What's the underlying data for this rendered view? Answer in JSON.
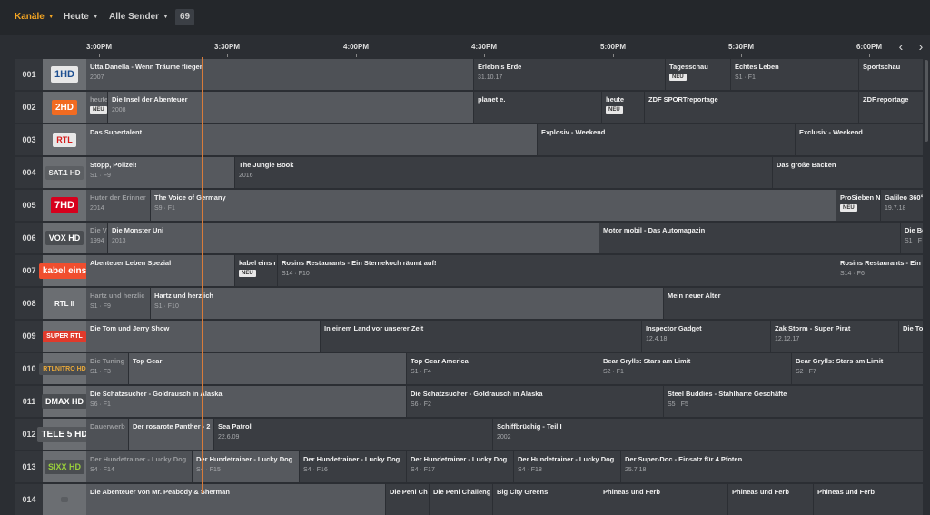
{
  "nav": {
    "items": [
      {
        "label": "Kanäle",
        "active": true
      },
      {
        "label": "Heute",
        "active": false
      },
      {
        "label": "Alle Sender",
        "active": false
      }
    ],
    "count": "69"
  },
  "timeline": {
    "times": [
      "3:00PM",
      "3:30PM",
      "4:00PM",
      "4:30PM",
      "5:00PM",
      "5:30PM",
      "6:00PM"
    ]
  },
  "colors": {
    "accent": "#f5a623",
    "now_line": "#d77b3a"
  },
  "channels": [
    {
      "num": "001",
      "logo": "1HD",
      "programs": [
        {
          "title": "Utta Danella - Wenn Träume fliegen",
          "sub": "2007"
        },
        {
          "title": "Erlebnis Erde",
          "sub": "31.10.17"
        },
        {
          "title": "Tagesschau",
          "badge": "NEU"
        },
        {
          "title": "Echtes Leben",
          "sub": "S1 · F1"
        },
        {
          "title": "Sportschau"
        }
      ]
    },
    {
      "num": "002",
      "logo": "2HD",
      "programs": [
        {
          "title": "heute",
          "badge": "NEU"
        },
        {
          "title": "Die Insel der Abenteuer",
          "sub": "2008"
        },
        {
          "title": "planet e."
        },
        {
          "title": "heute",
          "badge": "NEU"
        },
        {
          "title": "ZDF SPORTreportage"
        },
        {
          "title": "ZDF.reportage"
        }
      ]
    },
    {
      "num": "003",
      "logo": "RTL",
      "programs": [
        {
          "title": "Das Supertalent"
        },
        {
          "title": "Explosiv - Weekend"
        },
        {
          "title": "Exclusiv - Weekend"
        }
      ]
    },
    {
      "num": "004",
      "logo": "SAT.1 HD",
      "programs": [
        {
          "title": "Stopp, Polizei!",
          "sub": "S1 · F9"
        },
        {
          "title": "The Jungle Book",
          "sub": "2016"
        },
        {
          "title": "Das große Backen"
        }
      ]
    },
    {
      "num": "005",
      "logo": "7HD",
      "programs": [
        {
          "title": "Huter der Erinner",
          "sub": "2014"
        },
        {
          "title": "The Voice of Germany",
          "sub": "S9 · F1"
        },
        {
          "title": "ProSieben N",
          "badge": "NEU"
        },
        {
          "title": "Galileo 360°",
          "sub": "19.7.18"
        }
      ]
    },
    {
      "num": "006",
      "logo": "VOX HD",
      "programs": [
        {
          "title": "Die V",
          "sub": "1994"
        },
        {
          "title": "Die Monster Uni",
          "sub": "2013"
        },
        {
          "title": "Motor mobil - Das Automagazin"
        },
        {
          "title": "Die Bo",
          "sub": "S1 · F"
        }
      ]
    },
    {
      "num": "007",
      "logo": "kabel eins",
      "programs": [
        {
          "title": "Abenteuer Leben Spezial"
        },
        {
          "title": "kabel eins r",
          "badge": "NEU"
        },
        {
          "title": "Rosins Restaurants - Ein Sternekoch räumt auf!",
          "sub": "S14 · F10"
        },
        {
          "title": "Rosins Restaurants - Ein",
          "sub": "S14 · F6"
        }
      ]
    },
    {
      "num": "008",
      "logo": "RTL II",
      "programs": [
        {
          "title": "Hartz und herzlic",
          "sub": "S1 · F9"
        },
        {
          "title": "Hartz und herzlich",
          "sub": "S1 · F10"
        },
        {
          "title": "Mein neuer Alter"
        }
      ]
    },
    {
      "num": "009",
      "logo": "SUPER RTL",
      "programs": [
        {
          "title": "Die Tom und Jerry Show"
        },
        {
          "title": "In einem Land vor unserer Zeit"
        },
        {
          "title": "Inspector Gadget",
          "sub": "12.4.18"
        },
        {
          "title": "Zak Storm - Super Pirat",
          "sub": "12.12.17"
        },
        {
          "title": "Die To"
        }
      ]
    },
    {
      "num": "010",
      "logo": "RTLNITRO HD",
      "programs": [
        {
          "title": "Die Tuning",
          "sub": "S1 · F3"
        },
        {
          "title": "Top Gear"
        },
        {
          "title": "Top Gear America",
          "sub": "S1 · F4"
        },
        {
          "title": "Bear Grylls: Stars am Limit",
          "sub": "S2 · F1"
        },
        {
          "title": "Bear Grylls: Stars am Limit",
          "sub": "S2 · F7"
        }
      ]
    },
    {
      "num": "011",
      "logo": "DMAX HD",
      "programs": [
        {
          "title": "Die Schatzsucher - Goldrausch in Alaska",
          "sub": "S6 · F1"
        },
        {
          "title": "Die Schatzsucher - Goldrausch in Alaska",
          "sub": "S6 · F2"
        },
        {
          "title": "Steel Buddies - Stahlharte Geschäfte",
          "sub": "S5 · F5"
        }
      ]
    },
    {
      "num": "012",
      "logo": "TELE 5 HD",
      "programs": [
        {
          "title": "Dauerwerb"
        },
        {
          "title": "Der rosarote Panther - 2"
        },
        {
          "title": "Sea Patrol",
          "sub": "22.6.09"
        },
        {
          "title": "Schiffbrüchig - Teil I",
          "sub": "2002"
        }
      ]
    },
    {
      "num": "013",
      "logo": "SIXX HD",
      "programs": [
        {
          "title": "Der Hundetrainer - Lucky Dog",
          "sub": "S4 · F14"
        },
        {
          "title": "Der Hundetrainer - Lucky Dog",
          "sub": "S4 · F15"
        },
        {
          "title": "Der Hundetrainer - Lucky Dog",
          "sub": "S4 · F16"
        },
        {
          "title": "Der Hundetrainer - Lucky Dog",
          "sub": "S4 · F17"
        },
        {
          "title": "Der Hundetrainer - Lucky Dog",
          "sub": "S4 · F18"
        },
        {
          "title": "Der Super-Doc - Einsatz für 4 Pfoten",
          "sub": "25.7.18"
        },
        {
          "title": "Der Te",
          "sub": "27.5.1"
        }
      ]
    },
    {
      "num": "014",
      "logo": "",
      "programs": [
        {
          "title": "Die Abenteuer von Mr. Peabody & Sherman"
        },
        {
          "title": "Die Peni Ch"
        },
        {
          "title": "Die Peni Challeng"
        },
        {
          "title": "Big City Greens"
        },
        {
          "title": "Phineas und Ferb"
        },
        {
          "title": "Phineas und Ferb"
        },
        {
          "title": "Phineas und Ferb"
        },
        {
          "title": "Willkommen in Gr"
        }
      ]
    }
  ]
}
